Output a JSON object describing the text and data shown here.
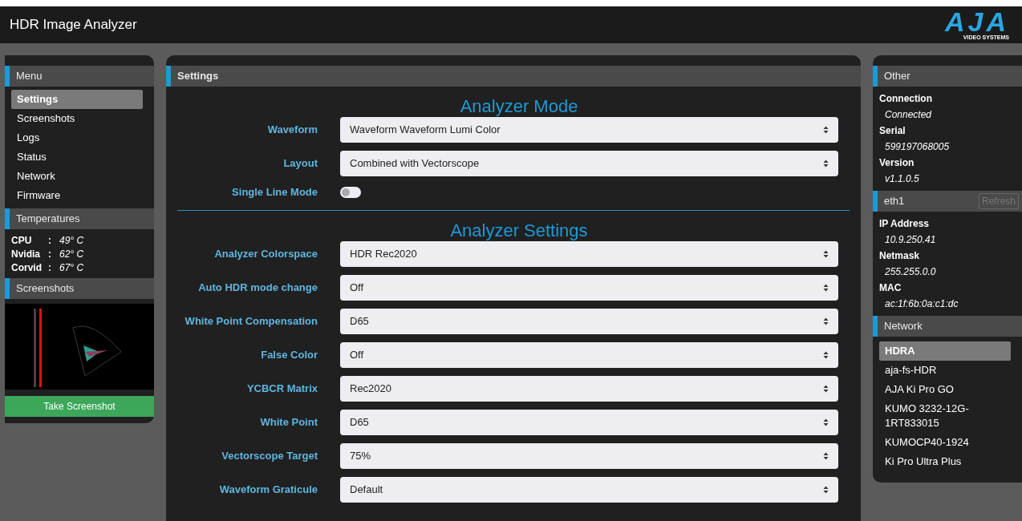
{
  "header": {
    "title": "HDR Image Analyzer",
    "logo": {
      "mark": "AJA",
      "sub": "VIDEO SYSTEMS"
    }
  },
  "menu": {
    "title": "Menu",
    "items": [
      {
        "label": "Settings",
        "selected": true
      },
      {
        "label": "Screenshots",
        "selected": false
      },
      {
        "label": "Logs",
        "selected": false
      },
      {
        "label": "Status",
        "selected": false
      },
      {
        "label": "Network",
        "selected": false
      },
      {
        "label": "Firmware",
        "selected": false
      }
    ]
  },
  "temperatures": {
    "title": "Temperatures",
    "rows": [
      {
        "name": "CPU",
        "sep": ":",
        "value": "49° C"
      },
      {
        "name": "Nvidia",
        "sep": ":",
        "value": "62° C"
      },
      {
        "name": "Corvid",
        "sep": ":",
        "value": "67° C"
      }
    ]
  },
  "screenshots": {
    "title": "Screenshots",
    "button": "Take Screenshot"
  },
  "settings": {
    "title": "Settings",
    "sections": [
      {
        "heading": "Analyzer Mode",
        "fields": [
          {
            "kind": "select",
            "label": "Waveform",
            "value": "Waveform Waveform Lumi Color"
          },
          {
            "kind": "select",
            "label": "Layout",
            "value": "Combined with Vectorscope"
          },
          {
            "kind": "toggle",
            "label": "Single Line Mode",
            "on": false
          }
        ]
      },
      {
        "heading": "Analyzer Settings",
        "fields": [
          {
            "kind": "select",
            "label": "Analyzer Colorspace",
            "value": "HDR Rec2020"
          },
          {
            "kind": "select",
            "label": "Auto HDR mode change",
            "value": "Off"
          },
          {
            "kind": "select",
            "label": "White Point Compensation",
            "value": "D65"
          },
          {
            "kind": "select",
            "label": "False Color",
            "value": "Off"
          },
          {
            "kind": "select",
            "label": "YCBCR Matrix",
            "value": "Rec2020"
          },
          {
            "kind": "select",
            "label": "White Point",
            "value": "D65"
          },
          {
            "kind": "select",
            "label": "Vectorscope Target",
            "value": "75%"
          },
          {
            "kind": "select",
            "label": "Waveform Graticule",
            "value": "Default"
          }
        ]
      }
    ]
  },
  "other": {
    "title": "Other",
    "items": [
      {
        "label": "Connection",
        "value": "Connected"
      },
      {
        "label": "Serial",
        "value": "599197068005"
      },
      {
        "label": "Version",
        "value": "v1.1.0.5"
      }
    ]
  },
  "eth": {
    "title": "eth1",
    "button": "Refresh",
    "button_disabled": true,
    "items": [
      {
        "label": "IP Address",
        "value": "10.9.250.41"
      },
      {
        "label": "Netmask",
        "value": "255.255.0.0"
      },
      {
        "label": "MAC",
        "value": "ac:1f:6b:0a:c1:dc"
      }
    ]
  },
  "network": {
    "title": "Network",
    "items": [
      {
        "label": "HDRA",
        "selected": true
      },
      {
        "label": "aja-fs-HDR",
        "selected": false
      },
      {
        "label": "AJA Ki Pro GO",
        "selected": false
      },
      {
        "label": "KUMO 3232-12G-1RT833015",
        "selected": false
      },
      {
        "label": "KUMOCP40-1924",
        "selected": false
      },
      {
        "label": "Ki Pro Ultra Plus",
        "selected": false
      }
    ]
  }
}
